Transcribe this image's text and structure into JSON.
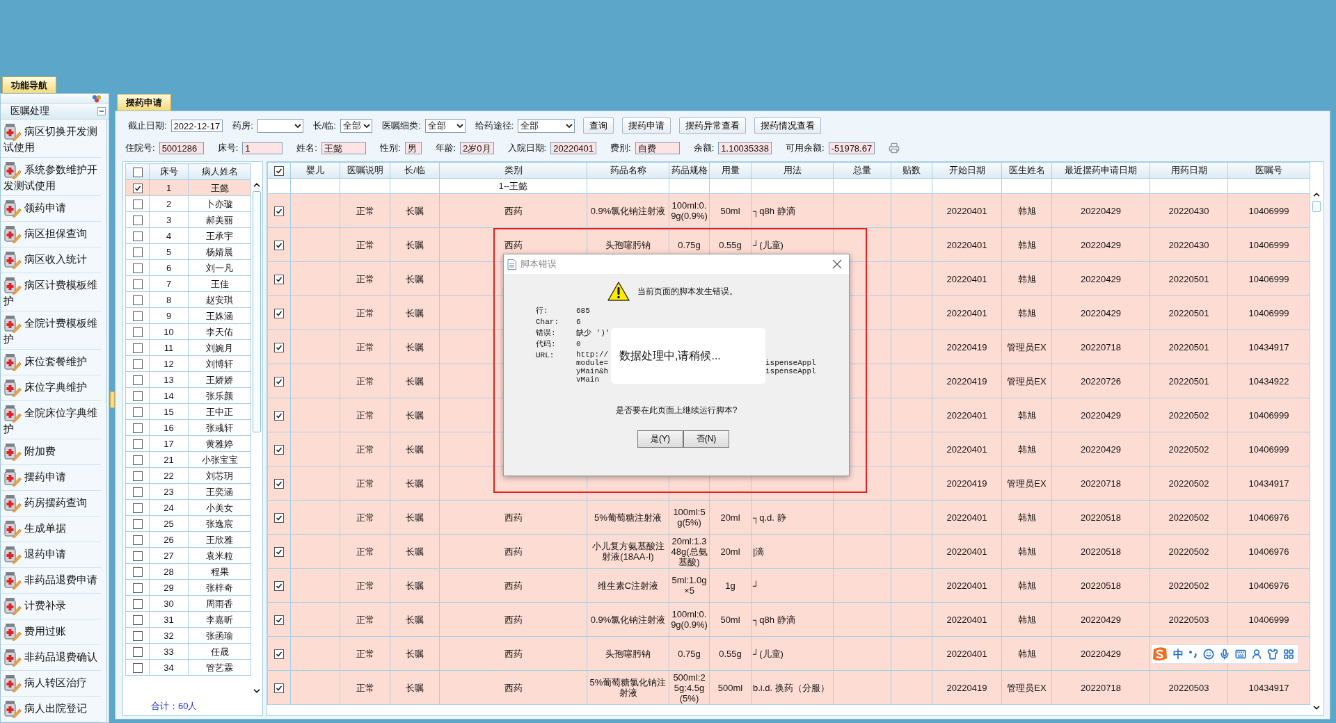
{
  "nav": {
    "tab": "功能导航",
    "section": "医嘱处理",
    "items": [
      {
        "label": "病区切换开发测试使用"
      },
      {
        "label": "系统参数维护开发测试使用"
      },
      {
        "label": "领药申请"
      },
      {
        "label": "病区担保查询"
      },
      {
        "label": "病区收入统计"
      },
      {
        "label": "病区计费模板维护"
      },
      {
        "label": "全院计费模板维护"
      },
      {
        "label": "床位套餐维护"
      },
      {
        "label": "床位字典维护"
      },
      {
        "label": "全院床位字典维护"
      },
      {
        "label": "附加费"
      },
      {
        "label": "摆药申请"
      },
      {
        "label": "药房摆药查询"
      },
      {
        "label": "生成单据"
      },
      {
        "label": "退药申请"
      },
      {
        "label": "非药品退费申请"
      },
      {
        "label": "计费补录"
      },
      {
        "label": "费用过账"
      },
      {
        "label": "非药品退费确认"
      },
      {
        "label": "病人转区治疗"
      },
      {
        "label": "病人出院登记"
      }
    ]
  },
  "tab": {
    "label": "摆药申请",
    "selected": true
  },
  "query_bar": {
    "fields": [
      {
        "label": "截止日期:",
        "value": "2022-12-17",
        "kind": "input"
      },
      {
        "label": "药房:",
        "kind": "select"
      },
      {
        "label": "长/临:",
        "value": "全部",
        "kind": "select"
      },
      {
        "label": "医嘱细类:",
        "value": "全部",
        "kind": "select"
      },
      {
        "label": "给药途径:",
        "value": "全部",
        "kind": "select"
      }
    ],
    "buttons": [
      "查询",
      "摆药申请",
      "摆药异常查看",
      "摆药情况查看"
    ]
  },
  "patient_info": [
    {
      "label": "住院号:",
      "value": "5001286"
    },
    {
      "label": "床号:",
      "value": "1"
    },
    {
      "label": "姓名:",
      "value": "王懿"
    },
    {
      "label": "性别:",
      "value": "男"
    },
    {
      "label": "年龄:",
      "value": "2岁0月"
    },
    {
      "label": "入院日期:",
      "value": "20220401"
    },
    {
      "label": "费别:",
      "value": "自费"
    },
    {
      "label": "余额:",
      "value": "1.10035338"
    },
    {
      "label": "可用余额:",
      "value": "-51978.67"
    }
  ],
  "patients": {
    "columns": [
      "床号",
      "病人姓名"
    ],
    "header_checked": false,
    "total": "合计：60人",
    "rows": [
      {
        "bed": "1",
        "name": "王懿",
        "checked": true,
        "selected": true
      },
      {
        "bed": "2",
        "name": "卜亦璇",
        "checked": false,
        "selected": false
      },
      {
        "bed": "3",
        "name": "郝美丽",
        "checked": false,
        "selected": false
      },
      {
        "bed": "4",
        "name": "王承宇",
        "checked": false,
        "selected": false
      },
      {
        "bed": "5",
        "name": "杨婧晨",
        "checked": false,
        "selected": false
      },
      {
        "bed": "6",
        "name": "刘一凡",
        "checked": false,
        "selected": false
      },
      {
        "bed": "7",
        "name": "王佳",
        "checked": false,
        "selected": false
      },
      {
        "bed": "8",
        "name": "赵安琪",
        "checked": false,
        "selected": false
      },
      {
        "bed": "9",
        "name": "王姝涵",
        "checked": false,
        "selected": false
      },
      {
        "bed": "10",
        "name": "李天佑",
        "checked": false,
        "selected": false
      },
      {
        "bed": "11",
        "name": "刘婉月",
        "checked": false,
        "selected": false
      },
      {
        "bed": "12",
        "name": "刘博轩",
        "checked": false,
        "selected": false
      },
      {
        "bed": "13",
        "name": "王娇娇",
        "checked": false,
        "selected": false
      },
      {
        "bed": "14",
        "name": "张乐颜",
        "checked": false,
        "selected": false
      },
      {
        "bed": "15",
        "name": "王中正",
        "checked": false,
        "selected": false
      },
      {
        "bed": "16",
        "name": "张彧轩",
        "checked": false,
        "selected": false
      },
      {
        "bed": "17",
        "name": "黄雅婷",
        "checked": false,
        "selected": false
      },
      {
        "bed": "21",
        "name": "小张宝宝",
        "checked": false,
        "selected": false
      },
      {
        "bed": "22",
        "name": "刘芯玥",
        "checked": false,
        "selected": false
      },
      {
        "bed": "23",
        "name": "王奕涵",
        "checked": false,
        "selected": false
      },
      {
        "bed": "24",
        "name": "小美女",
        "checked": false,
        "selected": false
      },
      {
        "bed": "25",
        "name": "张逸宸",
        "checked": false,
        "selected": false
      },
      {
        "bed": "26",
        "name": "王欣雅",
        "checked": false,
        "selected": false
      },
      {
        "bed": "27",
        "name": "袁米粒",
        "checked": false,
        "selected": false
      },
      {
        "bed": "28",
        "name": "程果",
        "checked": false,
        "selected": false
      },
      {
        "bed": "29",
        "name": "张梓奇",
        "checked": false,
        "selected": false
      },
      {
        "bed": "30",
        "name": "周雨香",
        "checked": false,
        "selected": false
      },
      {
        "bed": "31",
        "name": "李嘉昕",
        "checked": false,
        "selected": false
      },
      {
        "bed": "32",
        "name": "张函瑜",
        "checked": false,
        "selected": false
      },
      {
        "bed": "33",
        "name": "任晟",
        "checked": false,
        "selected": false
      },
      {
        "bed": "34",
        "name": "管艺霖",
        "checked": false,
        "selected": false
      }
    ]
  },
  "orders": {
    "header_checked": true,
    "group": "1--王懿",
    "columns": [
      "婴儿",
      "医嘱说明",
      "长/临",
      "类别",
      "药品名称",
      "药品规格",
      "用量",
      "用法",
      "总量",
      "贴数",
      "开始日期",
      "医生姓名",
      "最近摆药申请日期",
      "用药日期",
      "医嘱号"
    ],
    "rows": [
      {
        "checked": true,
        "note": "正常",
        "term": "长嘱",
        "category": "西药",
        "drug": "0.9%氯化钠注射液",
        "spec": "100ml:0.9g(0.9%)",
        "dose": "50ml",
        "usage": "┐q8h 静滴",
        "start": "20220401",
        "doctor": "韩旭",
        "last_request": "20220429",
        "use_date": "20220430",
        "order_no": "10406999"
      },
      {
        "checked": true,
        "note": "正常",
        "term": "长嘱",
        "category": "西药",
        "drug": "头孢噻肟钠",
        "spec": "0.75g",
        "dose": "0.55g",
        "usage": "┘(儿童)",
        "start": "20220401",
        "doctor": "韩旭",
        "last_request": "20220429",
        "use_date": "20220430",
        "order_no": "10406999"
      },
      {
        "checked": true,
        "note": "正常",
        "term": "长嘱",
        "start": "20220401",
        "doctor": "韩旭",
        "last_request": "20220429",
        "use_date": "20220501",
        "order_no": "10406999"
      },
      {
        "checked": true,
        "note": "正常",
        "term": "长嘱",
        "start": "20220401",
        "doctor": "韩旭",
        "last_request": "20220429",
        "use_date": "20220501",
        "order_no": "10406999"
      },
      {
        "checked": true,
        "note": "正常",
        "term": "长嘱",
        "start": "20220419",
        "doctor": "管理员EX",
        "last_request": "20220718",
        "use_date": "20220501",
        "order_no": "10434917"
      },
      {
        "checked": true,
        "note": "正常",
        "term": "长嘱",
        "start": "20220419",
        "doctor": "管理员EX",
        "last_request": "20220726",
        "use_date": "20220501",
        "order_no": "10434922"
      },
      {
        "checked": true,
        "note": "正常",
        "term": "长嘱",
        "start": "20220401",
        "doctor": "韩旭",
        "last_request": "20220429",
        "use_date": "20220502",
        "order_no": "10406999"
      },
      {
        "checked": true,
        "note": "正常",
        "term": "长嘱",
        "start": "20220401",
        "doctor": "韩旭",
        "last_request": "20220429",
        "use_date": "20220502",
        "order_no": "10406999"
      },
      {
        "checked": true,
        "note": "正常",
        "term": "长嘱",
        "start": "20220419",
        "doctor": "管理员EX",
        "last_request": "20220718",
        "use_date": "20220502",
        "order_no": "10434917"
      },
      {
        "checked": true,
        "note": "正常",
        "term": "长嘱",
        "category": "西药",
        "drug": "5%葡萄糖注射液",
        "spec": "100ml:5g(5%)",
        "dose": "20ml",
        "usage": "┐q.d. 静",
        "start": "20220401",
        "doctor": "韩旭",
        "last_request": "20220518",
        "use_date": "20220502",
        "order_no": "10406976"
      },
      {
        "checked": true,
        "note": "正常",
        "term": "长嘱",
        "category": "西药",
        "drug": "小儿复方氨基酸注射液(18AA-I)",
        "spec": "20ml:1.348g(总氨基酸)",
        "dose": "20ml",
        "usage": "|滴",
        "start": "20220401",
        "doctor": "韩旭",
        "last_request": "20220518",
        "use_date": "20220502",
        "order_no": "10406976"
      },
      {
        "checked": true,
        "note": "正常",
        "term": "长嘱",
        "category": "西药",
        "drug": "维生素C注射液",
        "spec": "5ml:1.0g×5",
        "dose": "1g",
        "usage": "┘",
        "start": "20220401",
        "doctor": "韩旭",
        "last_request": "20220518",
        "use_date": "20220502",
        "order_no": "10406976"
      },
      {
        "checked": true,
        "note": "正常",
        "term": "长嘱",
        "category": "西药",
        "drug": "0.9%氯化钠注射液",
        "spec": "100ml:0.9g(0.9%)",
        "dose": "50ml",
        "usage": "┐q8h 静滴",
        "start": "20220401",
        "doctor": "韩旭",
        "last_request": "20220429",
        "use_date": "20220503",
        "order_no": "10406999"
      },
      {
        "checked": true,
        "note": "正常",
        "term": "长嘱",
        "category": "西药",
        "drug": "头孢噻肟钠",
        "spec": "0.75g",
        "dose": "0.55g",
        "usage": "┘(儿童)",
        "start": "20220401",
        "doctor": "韩旭",
        "last_request": "20220429"
      },
      {
        "checked": true,
        "note": "正常",
        "term": "长嘱",
        "category": "西药",
        "drug": "5%葡萄糖氯化钠注射液",
        "spec": "500ml:25g:4.5g(5%)",
        "dose": "500ml",
        "usage": "b.i.d. 换药（分服）",
        "start": "20220419",
        "doctor": "管理员EX",
        "last_request": "20220718",
        "use_date": "20220503",
        "order_no": "10434917"
      }
    ]
  },
  "dialog": {
    "title": "脚本错误",
    "message": "当前页面的脚本发生错误。",
    "details": [
      {
        "label": "行:",
        "value": "685"
      },
      {
        "label": "Char:",
        "value": "6"
      },
      {
        "label": "错误:",
        "value": "缺少 ')'"
      },
      {
        "label": "代码:",
        "value": "0"
      }
    ],
    "url_label": "URL:",
    "url_lines": [
      {
        "left": "http://"
      },
      {
        "left": "module=",
        "right": "ispenseAppl"
      },
      {
        "left": "yMain&h",
        "right": "ispenseAppl"
      },
      {
        "left": "vMain"
      }
    ],
    "question": "是否要在此页面上继续运行脚本?",
    "buttons": [
      "是(Y)",
      "否(N)"
    ]
  },
  "loading": {
    "message": "数据处理中,请稍候..."
  },
  "ime": {
    "mode": "中"
  }
}
